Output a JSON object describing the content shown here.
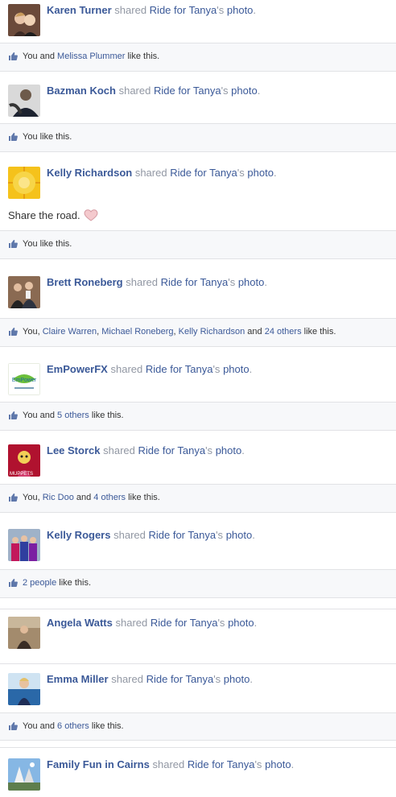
{
  "strings": {
    "shared": "shared",
    "apostrophe_s": "'s",
    "and": "and",
    "like_this": "like this.",
    "like_this_single": "like this."
  },
  "posts": [
    {
      "name": "Karen Turner",
      "page": "Ride for Tanya",
      "object": "photo",
      "likes": {
        "you": "You and",
        "names": [
          "Melissa Plummer"
        ],
        "tail": "like this."
      }
    },
    {
      "name": "Bazman Koch",
      "page": "Ride for Tanya",
      "object": "photo",
      "likes": {
        "you": "You like this."
      }
    },
    {
      "name": "Kelly Richardson",
      "page": "Ride for Tanya",
      "object": "photo",
      "text": "Share the road.",
      "likes": {
        "you": "You like this."
      }
    },
    {
      "name": "Brett Roneberg",
      "page": "Ride for Tanya",
      "object": "photo",
      "likes": {
        "you": "You,",
        "names": [
          "Claire Warren",
          "Michael Roneberg",
          "Kelly Richardson"
        ],
        "and": "and",
        "others": "24 others",
        "tail": "like this."
      }
    },
    {
      "name": "EmPowerFX",
      "page": "Ride for Tanya",
      "object": "photo",
      "likes": {
        "you": "You and",
        "others": "5 others",
        "tail": "like this."
      }
    },
    {
      "name": "Lee Storck",
      "page": "Ride for Tanya",
      "object": "photo",
      "likes": {
        "you": "You,",
        "names": [
          "Ric Doo"
        ],
        "and": "and",
        "others": "4 others",
        "tail": "like this."
      }
    },
    {
      "name": "Kelly Rogers",
      "page": "Ride for Tanya",
      "object": "photo",
      "likes": {
        "others": "2 people",
        "tail": "like this."
      }
    },
    {
      "name": "Angela Watts",
      "page": "Ride for Tanya",
      "object": "photo"
    },
    {
      "name": "Emma Miller",
      "page": "Ride for Tanya",
      "object": "photo",
      "likes": {
        "you": "You and",
        "others": "6 others",
        "tail": "like this."
      }
    },
    {
      "name": "Family Fun in Cairns",
      "page": "Ride for Tanya",
      "object": "photo"
    }
  ],
  "colors": {
    "link": "#3b5998",
    "muted": "#9197a3",
    "border": "#e1e2e5",
    "footer_bg": "#f7f8fa"
  }
}
